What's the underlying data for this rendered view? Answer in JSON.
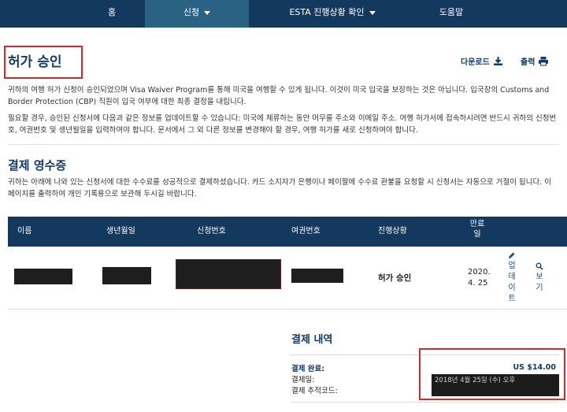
{
  "nav": {
    "items": [
      {
        "label": "홈"
      },
      {
        "label": "신청"
      },
      {
        "label": "ESTA 진행상황 확인"
      },
      {
        "label": "도움말"
      }
    ]
  },
  "header": {
    "title": "허가 승인",
    "download_label": "다운로드",
    "print_label": "출력"
  },
  "intro": {
    "p1": "귀하의 여행 허가 신청이 승인되었으며 Visa Waiver Program를 통해 미국을 여행할 수 있게 됩니다. 이것이 미국 입국을 보장하는 것은 아닙니다. 입국장의 Customs and Border Protection (CBP) 직원이 입국 여부에 대한 최종 결정을 내립니다.",
    "p2": "필요할 경우, 승인된 신청서에 다음과 같은 정보를 업데이트할 수 있습니다: 미국에 체류하는 동안 머무를 주소와 이메일 주소. 여행 허가서에 접속하시려면 반드시 귀하의 신청번호, 여권번호 및 생년월일을 입력하여야 합니다. 문서에서 그 외 다른 정보를 변경해야 할 경우, 여행 허가를 새로 신청하여야 합니다."
  },
  "receipt": {
    "title": "결제 영수증",
    "text": "귀하는 아래에 나와 있는 신청서에 대한 수수료를 성공적으로 결제하셨습니다. 카드 소지자가 은행이나 페이팔에 수수료 환불을 요청할 시 신청서는 자동으로 거절이 됩니다. 이 페이지를 출력하여 개인 기록용으로 보관해 두시길 바랍니다."
  },
  "table": {
    "headers": [
      "이름",
      "생년월일",
      "신청번호",
      "여권번호",
      "진행상황",
      "만료일"
    ],
    "row": {
      "status": "허가 승인",
      "expiry": "2020. 4. 25",
      "update_label": "업데이트",
      "view_label": "보기"
    }
  },
  "payment": {
    "title": "결제 내역",
    "complete_label": "결제 완료:",
    "amount": "US $14.00",
    "date_label": "결제일:",
    "tracking_label": "결제 추적코드:",
    "date_value": "2018년 4월 25일 (수) 오후"
  },
  "colors": {
    "nav_bg": "#14395e",
    "nav_active": "#2a6283",
    "brand_text": "#123a6a",
    "highlight_border": "#d42a2a"
  },
  "icons": [
    "download-icon",
    "print-icon",
    "pencil-icon",
    "search-icon",
    "chevron-down-icon"
  ]
}
